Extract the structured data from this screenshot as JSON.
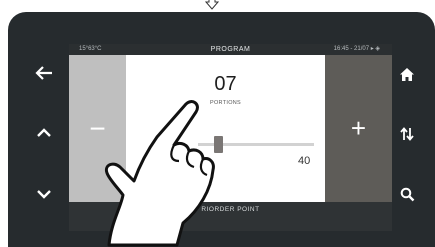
{
  "screen": {
    "status": {
      "left": "15°63°C",
      "title": "PROGRAM",
      "right": "16:45 - 21/07 ▸ ◈"
    },
    "minus_label": "−",
    "plus_label": "+",
    "value": "07",
    "unit": "PORTIONS",
    "slider": {
      "max_label": "40",
      "min": 0,
      "max": 40,
      "current": 7
    },
    "bottom_label": "RIORDER POINT"
  },
  "side_buttons": {
    "left": [
      "back-arrow-icon",
      "chevron-up-icon",
      "chevron-down-icon"
    ],
    "right": [
      "home-icon",
      "sort-arrows-icon",
      "search-icon"
    ]
  },
  "colors": {
    "device": "#262b2e",
    "minus_panel": "#bfbfbf",
    "plus_panel": "#5e5c58",
    "knob": "#7a7674"
  }
}
